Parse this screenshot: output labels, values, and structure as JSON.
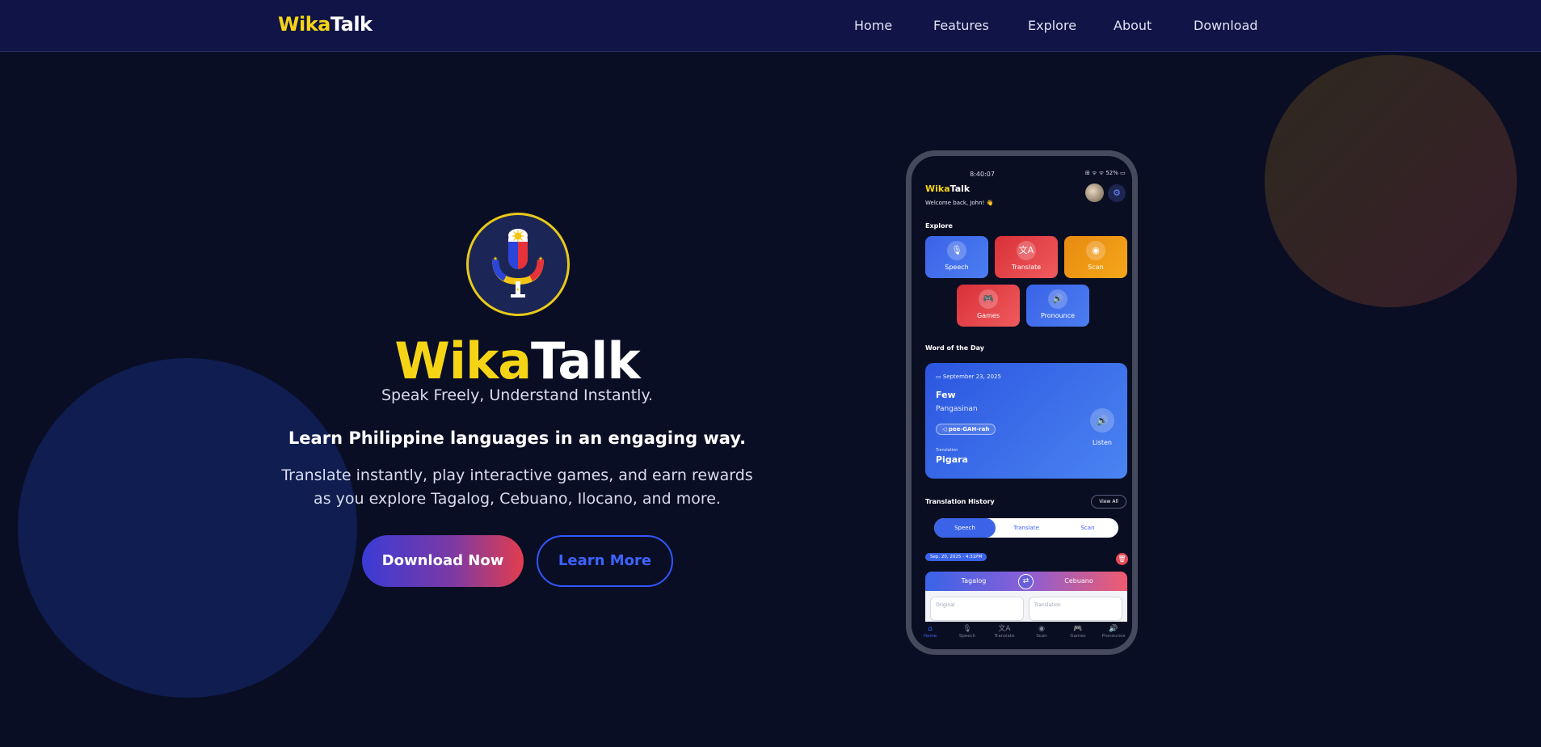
{
  "brand": {
    "wika": "Wika",
    "talk": "Talk"
  },
  "nav": {
    "links": [
      "Home",
      "Features",
      "Explore",
      "About",
      "Download"
    ]
  },
  "hero": {
    "tagline": "Speak Freely, Understand Instantly.",
    "headline": "Learn Philippine languages in an engaging way.",
    "description": "Translate instantly, play interactive games, and earn rewards as you explore Tagalog, Cebuano, Ilocano, and more.",
    "download_button": "Download Now",
    "learn_button": "Learn More"
  },
  "phone": {
    "status_time": "8:40:07",
    "status_icons": "⊞ ᯤ ᯤ 52% ▭",
    "welcome": "Welcome back, John! 👋",
    "explore_title": "Explore",
    "tiles": [
      {
        "label": "Speech",
        "icon": "microphone-icon",
        "glyph": "🎙"
      },
      {
        "label": "Translate",
        "icon": "translate-icon",
        "glyph": "文A"
      },
      {
        "label": "Scan",
        "icon": "camera-icon",
        "glyph": "◉"
      },
      {
        "label": "Games",
        "icon": "gamepad-icon",
        "glyph": "🎮"
      },
      {
        "label": "Pronounce",
        "icon": "speaker-icon",
        "glyph": "🔊"
      }
    ],
    "wod_title": "Word of the Day",
    "wod": {
      "date": "September 23, 2025",
      "word": "Few",
      "language": "Pangasinan",
      "pronunciation": "pee-GAH-rah",
      "translation_label": "Translation",
      "translation": "Pigara",
      "listen": "Listen"
    },
    "history_title": "Translation History",
    "view_all": "View All",
    "segments": [
      "Speech",
      "Translate",
      "Scan"
    ],
    "history_date": "Sep. 20, 2025 - 4:31PM",
    "lang_from": "Tagalog",
    "lang_to": "Cebuano",
    "original_placeholder": "Original",
    "translation_placeholder": "Translation",
    "tabs": [
      {
        "label": "Home",
        "glyph": "⌂"
      },
      {
        "label": "Speech",
        "glyph": "🎙"
      },
      {
        "label": "Translate",
        "glyph": "文A"
      },
      {
        "label": "Scan",
        "glyph": "◉"
      },
      {
        "label": "Games",
        "glyph": "🎮"
      },
      {
        "label": "Pronounce",
        "glyph": "🔊"
      }
    ]
  },
  "colors": {
    "background": "#0a0e24",
    "nav": "#101446",
    "accent_yellow": "#f5d415",
    "accent_blue": "#3a63e8",
    "accent_red": "#e23d4e"
  }
}
